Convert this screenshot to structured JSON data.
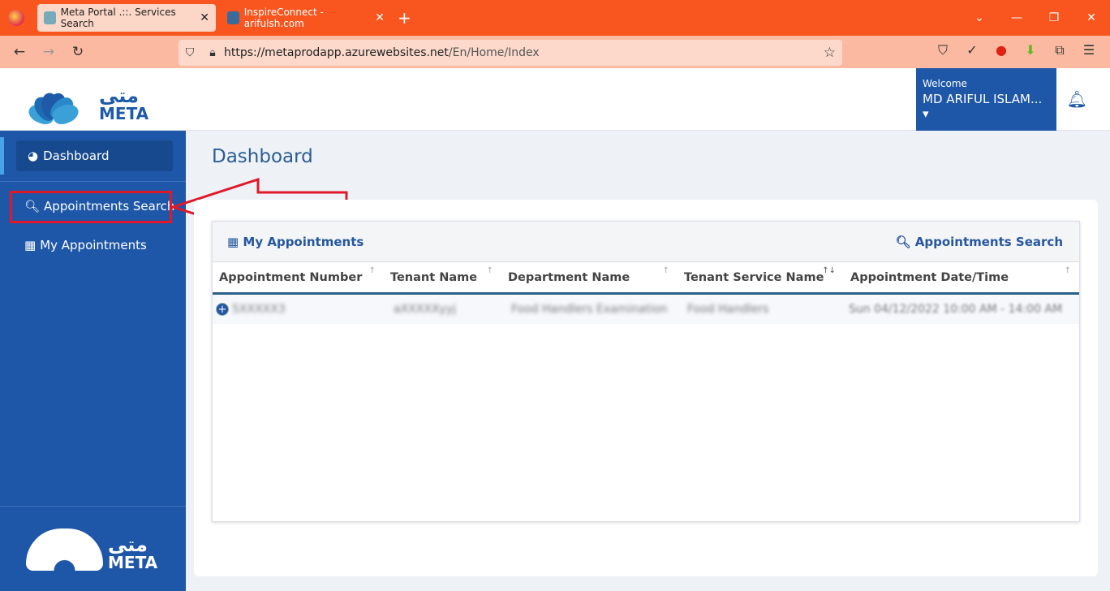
{
  "browser": {
    "tabs": [
      {
        "title": "Meta Portal .::. Services Search",
        "active": true
      },
      {
        "title": "InspireConnect - arifulsh.com",
        "active": false
      }
    ],
    "url_host": "https://metaprodapp.azurewebsites.net",
    "url_path": "/En/Home/Index"
  },
  "header": {
    "logo_text": "META",
    "logo_arabic": "متى",
    "welcome": "Welcome",
    "user": "MD ARIFUL ISLAM...",
    "brand_color": "#1e57a8"
  },
  "sidebar": {
    "items": [
      {
        "label": "Dashboard",
        "icon": "dashboard-icon"
      },
      {
        "label": "Appointments Search",
        "icon": "search-icon"
      },
      {
        "label": "My Appointments",
        "icon": "calendar-icon"
      }
    ]
  },
  "page": {
    "title": "Dashboard"
  },
  "card": {
    "title": "My Appointments",
    "search_link": "Appointments Search",
    "columns": [
      "Appointment Number",
      "Tenant Name",
      "Department Name",
      "Tenant Service Name",
      "Appointment Date/Time"
    ],
    "rows": [
      [
        "5XXXXX3",
        "aXXXXXyyj",
        "Food Handlers Examination",
        "Food Handlers",
        "Sun 04/12/2022 10:00 AM - 14:00 AM"
      ]
    ]
  }
}
